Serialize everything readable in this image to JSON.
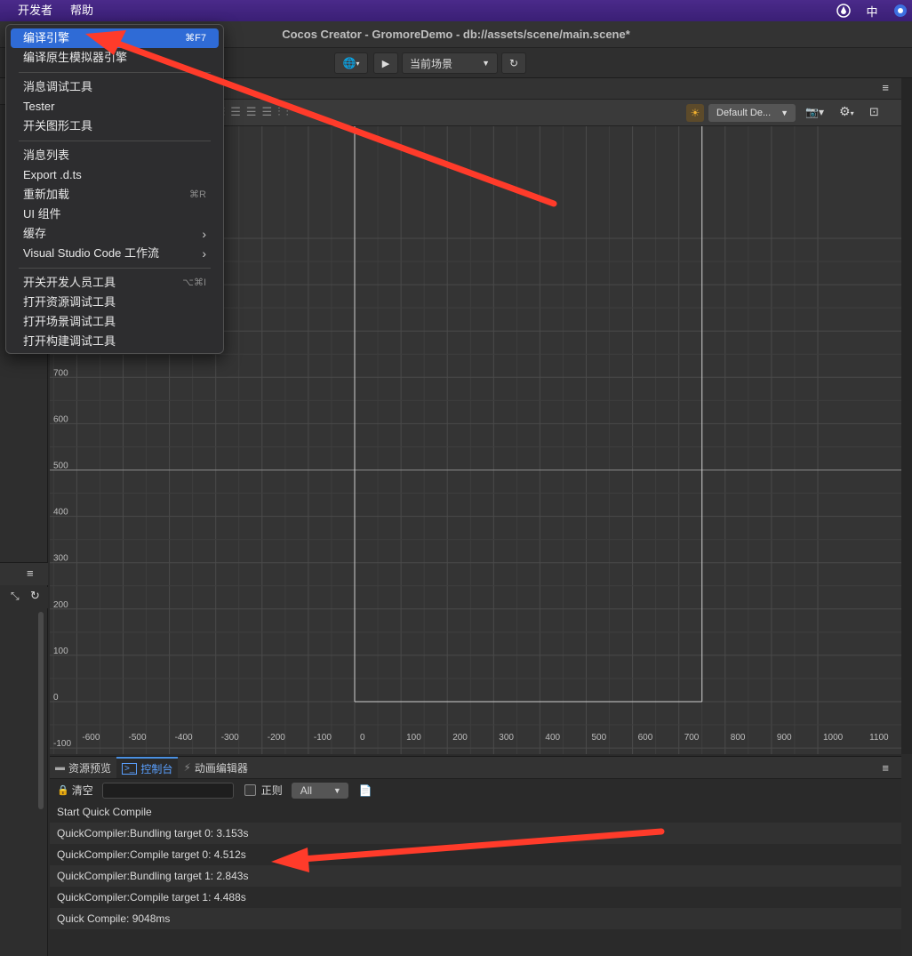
{
  "menubar": {
    "items": [
      "开发者",
      "帮助"
    ],
    "ime_label": "中"
  },
  "window_title": "Cocos Creator - GromoreDemo - db://assets/scene/main.scene*",
  "toolbar": {
    "scene_select": "当前场景"
  },
  "scene_toolbar": {
    "layout_dropdown": "Default De..."
  },
  "developer_menu": {
    "groups": [
      [
        {
          "label": "编译引擎",
          "shortcut": "⌘F7",
          "selected": true
        },
        {
          "label": "编译原生模拟器引擎",
          "shortcut": ""
        }
      ],
      [
        {
          "label": "消息调试工具",
          "shortcut": ""
        },
        {
          "label": "Tester",
          "shortcut": ""
        },
        {
          "label": "开关图形工具",
          "shortcut": ""
        }
      ],
      [
        {
          "label": "消息列表",
          "shortcut": ""
        },
        {
          "label": "Export .d.ts",
          "shortcut": ""
        },
        {
          "label": "重新加载",
          "shortcut": "⌘R"
        },
        {
          "label": "UI 组件",
          "shortcut": ""
        },
        {
          "label": "缓存",
          "shortcut": "",
          "submenu": true
        },
        {
          "label": "Visual Studio Code 工作流",
          "shortcut": "",
          "submenu": true
        }
      ],
      [
        {
          "label": "开关开发人员工具",
          "shortcut": "⌥⌘I"
        },
        {
          "label": "打开资源调试工具",
          "shortcut": ""
        },
        {
          "label": "打开场景调试工具",
          "shortcut": ""
        },
        {
          "label": "打开构建调试工具",
          "shortcut": ""
        }
      ]
    ]
  },
  "viewport": {
    "y_ticks": [
      "700",
      "600",
      "500",
      "400",
      "300",
      "200",
      "100",
      "0",
      "-100"
    ],
    "x_ticks": [
      "-600",
      "-500",
      "-400",
      "-300",
      "-200",
      "-100",
      "0",
      "100",
      "200",
      "300",
      "400",
      "500",
      "600",
      "700",
      "800",
      "900",
      "1000",
      "1100"
    ]
  },
  "console_panel": {
    "tabs": [
      {
        "label": "资源预览",
        "icon": "folder-icon",
        "active": false
      },
      {
        "label": "控制台",
        "icon": "terminal-icon",
        "active": true
      },
      {
        "label": "动画编辑器",
        "icon": "animation-icon",
        "active": false
      }
    ],
    "clear_label": "清空",
    "filter_placeholder": "",
    "regex_label": "正则",
    "level_select": "All",
    "logs": [
      "Start Quick Compile",
      "QuickCompiler:Bundling target 0: 3.153s",
      "QuickCompiler:Compile target 0: 4.512s",
      "QuickCompiler:Bundling target 1: 2.843s",
      "QuickCompiler:Compile target 1: 4.488s",
      "Quick Compile: 9048ms"
    ]
  },
  "colors": {
    "menubar": "#3a1f75",
    "selection": "#2f6bd6",
    "annotation_arrow": "#ff3b2a",
    "active_tab": "#5aa0ff"
  }
}
